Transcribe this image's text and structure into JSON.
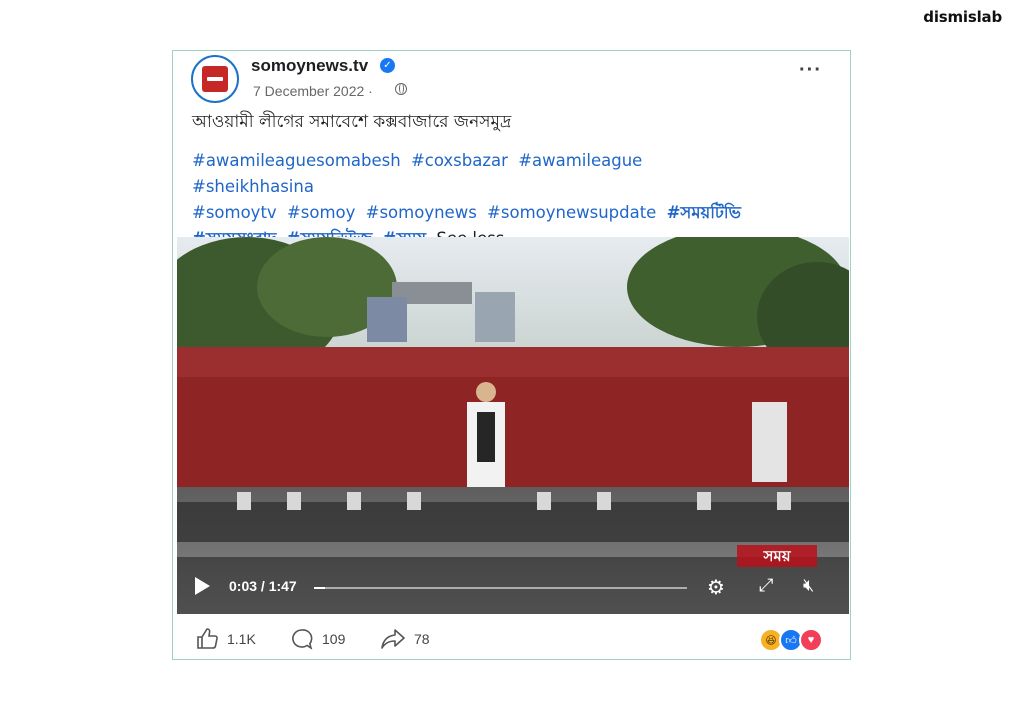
{
  "watermark": "dismislab",
  "post": {
    "page_name": "somoynews.tv",
    "date": "7 December 2022 ·",
    "caption": "আওয়ামী লীগের সমাবেশে কক্সবাজারে জনসমুদ্র",
    "hashtags_line1": [
      "#awamileaguesomabesh",
      "#coxsbazar",
      "#awamileague",
      "#sheikhhasina"
    ],
    "hashtags_line2": [
      "#somoytv",
      "#somoy",
      "#somoynews",
      "#somoynewsupdate",
      "#সময়টিভি"
    ],
    "hashtags_line3": [
      "#সময়সংবাদ",
      "#সময়নিউজ",
      "#সময়"
    ],
    "see_less": "See less"
  },
  "video": {
    "channel_logo": "সময়",
    "time": "0:03 / 1:47",
    "progress": 0.03,
    "controls": [
      "play-icon",
      "settings-icon",
      "fullscreen-icon",
      "mute-icon"
    ]
  },
  "stats": {
    "likes": "1.1K",
    "comments": "109",
    "shares": "78",
    "reaction_icons": [
      "haha-icon",
      "like-icon",
      "love-icon"
    ]
  },
  "colors": {
    "accent": "#1877f2",
    "hashtag": "#2066c9",
    "border": "#9dd3c2"
  }
}
